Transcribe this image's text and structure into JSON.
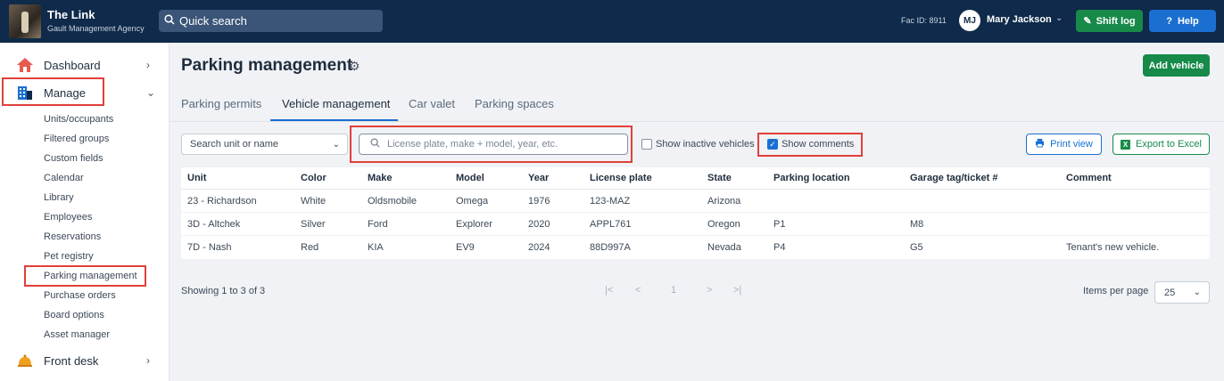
{
  "header": {
    "org_name": "The Link",
    "org_sub": "Gault Management Agency",
    "search_placeholder": "Quick search",
    "fac_id": "Fac ID: 8911",
    "user_initials": "MJ",
    "user_name": "Mary Jackson",
    "shift_log": "Shift log",
    "help": "Help"
  },
  "sidebar": {
    "dashboard": "Dashboard",
    "manage": "Manage",
    "front_desk": "Front desk",
    "sub_items": [
      "Units/occupants",
      "Filtered groups",
      "Custom fields",
      "Calendar",
      "Library",
      "Employees",
      "Reservations",
      "Pet registry",
      "Parking management",
      "Purchase orders",
      "Board options",
      "Asset manager"
    ]
  },
  "page": {
    "title": "Parking management",
    "add_vehicle": "Add vehicle",
    "tabs": [
      "Parking permits",
      "Vehicle management",
      "Car valet",
      "Parking spaces"
    ]
  },
  "filters": {
    "unit_select": "Search unit or name",
    "search_placeholder": "License plate, make + model, year, etc.",
    "show_inactive": "Show inactive vehicles",
    "show_comments": "Show comments",
    "print_view": "Print view",
    "export_excel": "Export to Excel"
  },
  "table": {
    "columns": [
      "Unit",
      "Color",
      "Make",
      "Model",
      "Year",
      "License plate",
      "State",
      "Parking location",
      "Garage tag/ticket #",
      "Comment"
    ],
    "rows": [
      [
        "23 - Richardson",
        "White",
        "Oldsmobile",
        "Omega",
        "1976",
        "123-MAZ",
        "Arizona",
        "",
        "",
        ""
      ],
      [
        "3D - Altchek",
        "Silver",
        "Ford",
        "Explorer",
        "2020",
        "APPL761",
        "Oregon",
        "P1",
        "M8",
        ""
      ],
      [
        "7D - Nash",
        "Red",
        "KIA",
        "EV9",
        "2024",
        "88D997A",
        "Nevada",
        "P4",
        "G5",
        "Tenant's new vehicle."
      ]
    ]
  },
  "pagination": {
    "showing": "Showing 1 to 3 of 3",
    "first": "|<",
    "prev": "<",
    "page": "1",
    "next": ">",
    "last": ">|",
    "items_per_page_label": "Items per page",
    "items_per_page": "25"
  },
  "colors": {
    "topbar": "#0f2a4a",
    "accent_blue": "#1a6fd1",
    "accent_green": "#178a4a",
    "highlight_red": "#e0403a"
  }
}
